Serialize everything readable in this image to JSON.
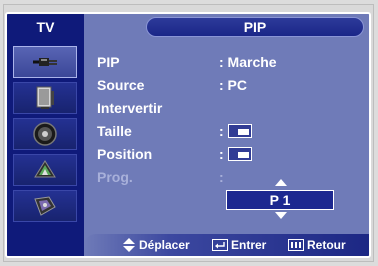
{
  "header": {
    "tv_label": "TV",
    "title": "PIP"
  },
  "sidebar": {
    "items": [
      {
        "icon": "plug-icon"
      },
      {
        "icon": "tv-screen-icon"
      },
      {
        "icon": "speaker-icon"
      },
      {
        "icon": "satellite-dish-icon"
      },
      {
        "icon": "setup-icon"
      }
    ],
    "active_index": 0
  },
  "menu": {
    "rows": [
      {
        "label": "PIP",
        "value": ": Marche"
      },
      {
        "label": "Source",
        "value": ": PC"
      },
      {
        "label": "Intervertir",
        "value": ""
      },
      {
        "label": "Taille",
        "value": ":"
      },
      {
        "label": "Position",
        "value": ":"
      },
      {
        "label": "Prog.",
        "value": ":"
      }
    ],
    "prog_value": "P 1"
  },
  "footer": {
    "move": "Déplacer",
    "enter": "Entrer",
    "back": "Retour"
  },
  "colors": {
    "panel": "#6f7bb8",
    "sidebar": "#0f1a7a",
    "highlight": "#1c2890",
    "text": "#ffffff",
    "dim_text": "#a8b0da"
  }
}
